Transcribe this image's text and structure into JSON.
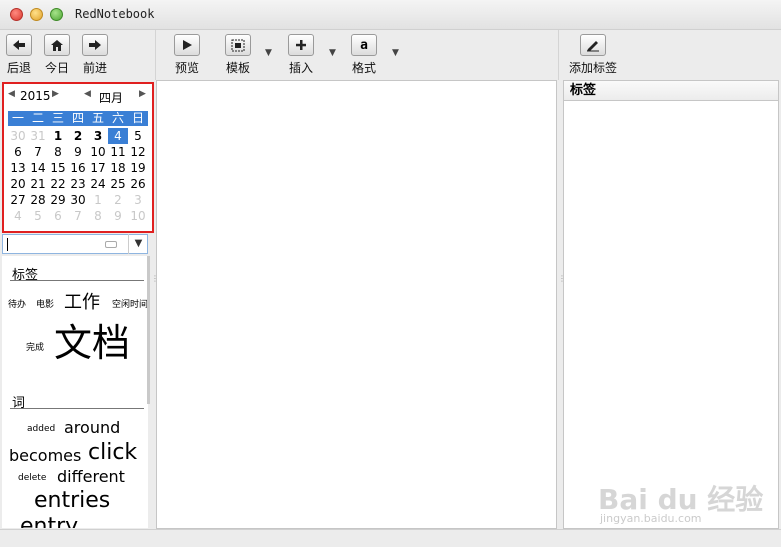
{
  "window": {
    "title": "RedNotebook"
  },
  "toolbar": {
    "back": "后退",
    "today": "今日",
    "forward": "前进",
    "preview": "预览",
    "template": "模板",
    "insert": "插入",
    "format": "格式",
    "format_icon_text": "a",
    "add_tag": "添加标签"
  },
  "calendar": {
    "year": "2015",
    "month": "四月",
    "weekdays": [
      "一",
      "二",
      "三",
      "四",
      "五",
      "六",
      "日"
    ],
    "days": [
      "30",
      "31",
      "1",
      "2",
      "3",
      "4",
      "5",
      "6",
      "7",
      "8",
      "9",
      "10",
      "11",
      "12",
      "13",
      "14",
      "15",
      "16",
      "17",
      "18",
      "19",
      "20",
      "21",
      "22",
      "23",
      "24",
      "25",
      "26",
      "27",
      "28",
      "29",
      "30",
      "1",
      "2",
      "3",
      "4",
      "5",
      "6",
      "7",
      "8",
      "9",
      "10"
    ],
    "selected_index": 5,
    "dim_indices": [
      0,
      1,
      32,
      33,
      34,
      35,
      36,
      37,
      38,
      39,
      40,
      41
    ],
    "bold_indices": [
      2,
      3,
      4
    ]
  },
  "left": {
    "tags_title": "标签",
    "tags": [
      "待办",
      "电影",
      "工作",
      "空闲时间",
      "完成",
      "文档"
    ],
    "words_title": "词",
    "words": [
      "added",
      "around",
      "becomes",
      "click",
      "delete",
      "different",
      "entries",
      "entry"
    ]
  },
  "right": {
    "header": "标签"
  },
  "watermark": {
    "main": "Bai du 经验",
    "sub": "jingyan.baidu.com"
  }
}
